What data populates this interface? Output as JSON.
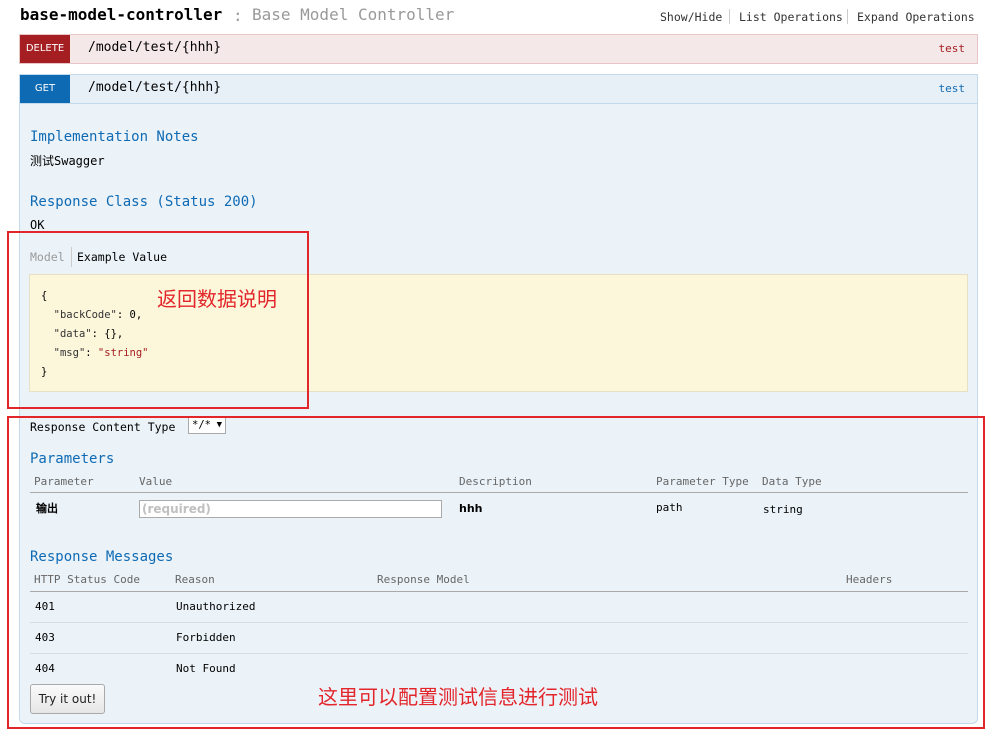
{
  "header": {
    "controller_name": "base-model-controller",
    "separator": ":",
    "controller_description": "Base Model Controller",
    "links": [
      "Show/Hide",
      "List Operations",
      "Expand Operations"
    ]
  },
  "operations": [
    {
      "method": "DELETE",
      "path": "/model/test/{hhh}",
      "tag": "test"
    },
    {
      "method": "GET",
      "path": "/model/test/{hhh}",
      "tag": "test"
    }
  ],
  "implementation_notes": {
    "title": "Implementation Notes",
    "text": "测试Swagger"
  },
  "response_class": {
    "title": "Response Class (Status 200)",
    "status_text": "OK",
    "tabs": {
      "model": "Model",
      "example": "Example Value"
    },
    "example_lines": [
      "{",
      "  \"backCode\": 0,",
      "  \"data\": {},",
      "  \"msg\": \"string\"",
      "}"
    ],
    "example_keys": [
      "\"backCode\"",
      "\"data\"",
      "\"msg\""
    ],
    "example_values": [
      "0",
      "{}",
      "\"string\""
    ]
  },
  "response_content_type": {
    "label": "Response Content Type",
    "selected": "*/*"
  },
  "parameters": {
    "title": "Parameters",
    "headers": [
      "Parameter",
      "Value",
      "Description",
      "Parameter Type",
      "Data Type"
    ],
    "rows": [
      {
        "name": "输出",
        "placeholder": "(required)",
        "description": "hhh",
        "param_type": "path",
        "data_type": "string"
      }
    ]
  },
  "response_messages": {
    "title": "Response Messages",
    "headers": [
      "HTTP Status Code",
      "Reason",
      "Response Model",
      "Headers"
    ],
    "rows": [
      {
        "code": "401",
        "reason": "Unauthorized"
      },
      {
        "code": "403",
        "reason": "Forbidden"
      },
      {
        "code": "404",
        "reason": "Not Found"
      }
    ]
  },
  "try_button_label": "Try it out!",
  "annotations": {
    "response_note": "返回数据说明",
    "test_note": "这里可以配置测试信息进行测试",
    "color": "#e3262b"
  },
  "colors": {
    "delete": "#a41e22",
    "get": "#0f6ab4",
    "section_title": "#0f6ab4"
  }
}
